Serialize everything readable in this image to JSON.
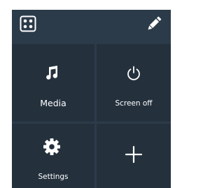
{
  "colors": {
    "panel_background": "#2c3b49",
    "tile_background": "#24313d",
    "foreground": "#ffffff"
  },
  "topbar": {
    "layout_icon": "grid-dots-icon",
    "edit_icon": "pencil-icon"
  },
  "tiles": [
    {
      "label": "Media",
      "icon": "music-note-icon"
    },
    {
      "label": "Screen off",
      "icon": "power-icon"
    },
    {
      "label": "Settings",
      "icon": "gear-icon"
    },
    {
      "label": "",
      "icon": "plus-icon"
    }
  ]
}
